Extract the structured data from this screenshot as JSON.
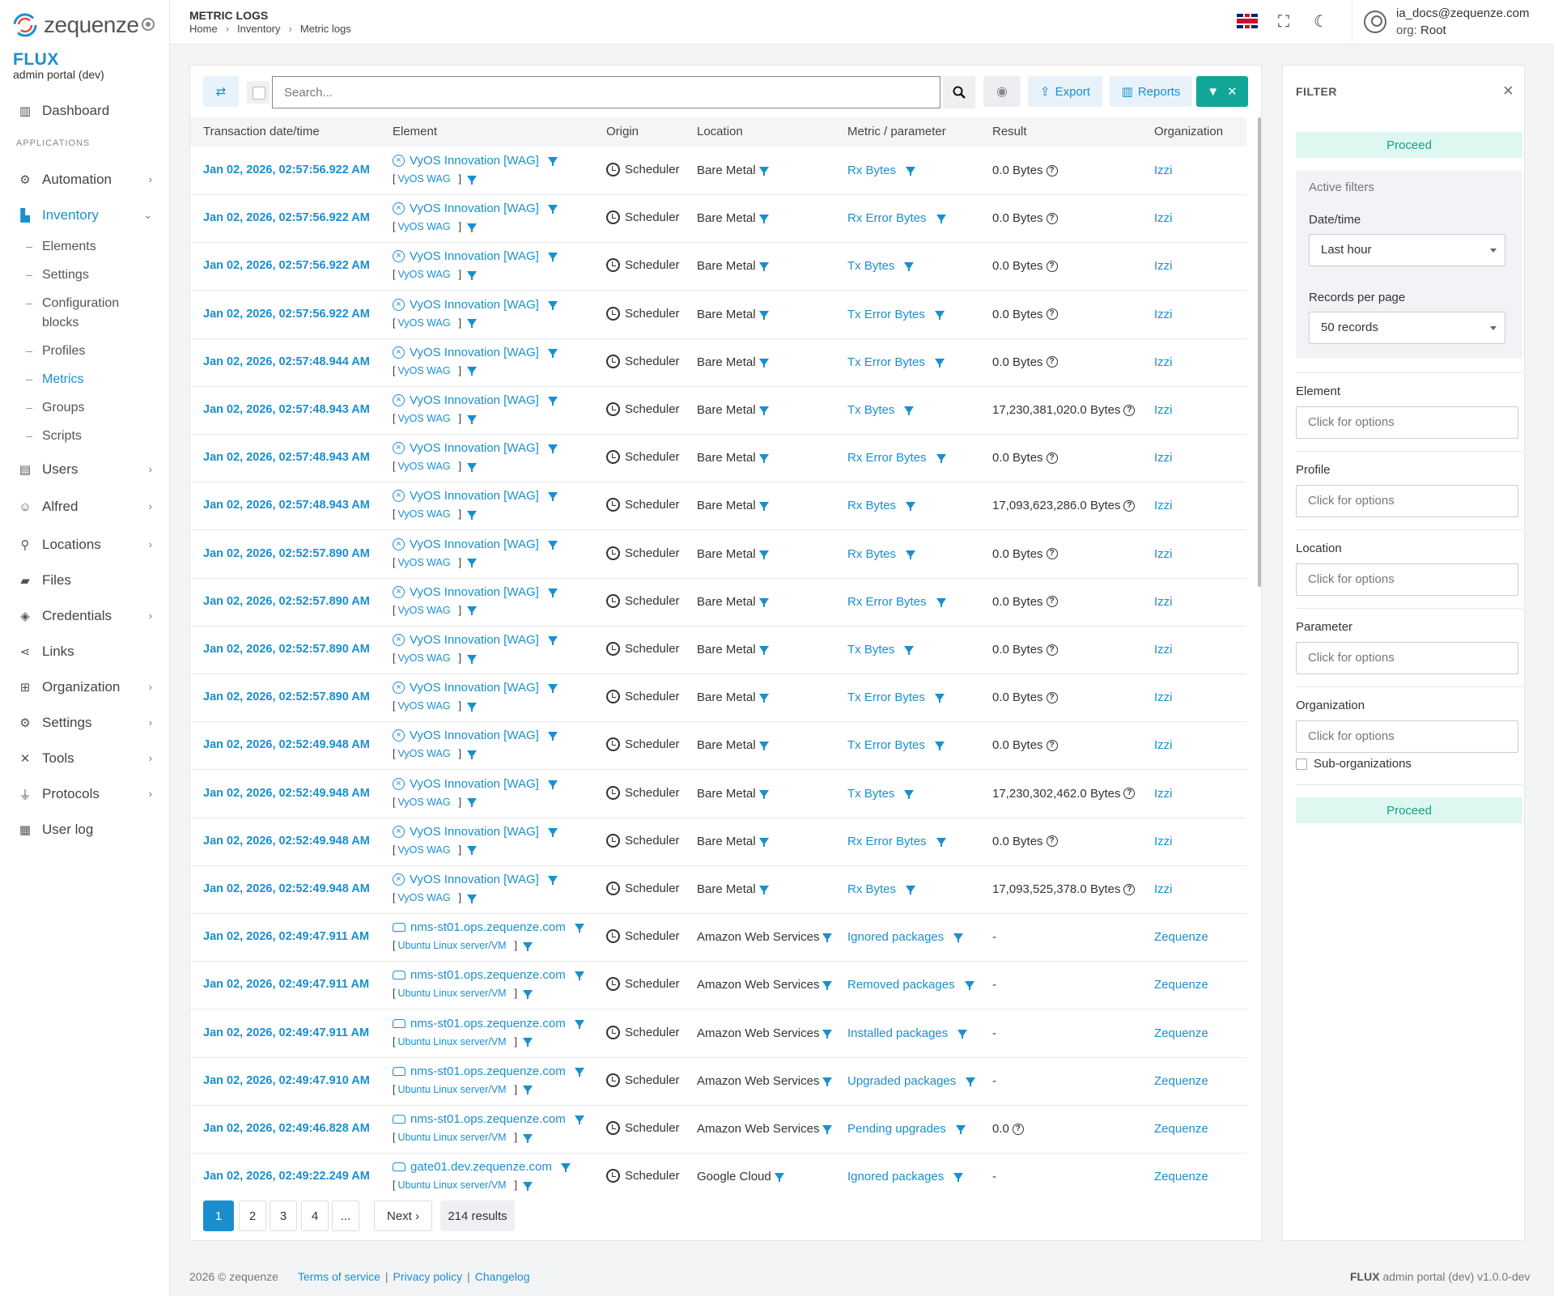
{
  "app": {
    "logo_text": "zequenze",
    "brand": "FLUX",
    "subtitle": "admin portal (dev)"
  },
  "sidebar": {
    "section_label": "APPLICATIONS",
    "items": [
      {
        "label": "Dashboard",
        "icon": "chart-icon"
      },
      {
        "label": "Automation",
        "icon": "automation-icon"
      },
      {
        "label": "Inventory",
        "icon": "inventory-icon"
      },
      {
        "label": "Users",
        "icon": "users-icon"
      },
      {
        "label": "Alfred",
        "icon": "alfred-icon"
      },
      {
        "label": "Locations",
        "icon": "location-pin-icon"
      },
      {
        "label": "Files",
        "icon": "folder-icon"
      },
      {
        "label": "Credentials",
        "icon": "shield-icon"
      },
      {
        "label": "Links",
        "icon": "share-icon"
      },
      {
        "label": "Organization",
        "icon": "org-icon"
      },
      {
        "label": "Settings",
        "icon": "gears-icon"
      },
      {
        "label": "Tools",
        "icon": "tools-icon"
      },
      {
        "label": "Protocols",
        "icon": "plug-icon"
      },
      {
        "label": "User log",
        "icon": "calendar-icon"
      }
    ],
    "inventory_sub": [
      "Elements",
      "Settings",
      "Configuration blocks",
      "Profiles",
      "Metrics",
      "Groups",
      "Scripts"
    ]
  },
  "header": {
    "title": "METRIC LOGS",
    "breadcrumb": [
      "Home",
      "Inventory",
      "Metric logs"
    ],
    "user_email": "ia_docs@zequenze.com",
    "org_label": "org:",
    "org_value": "Root"
  },
  "toolbar": {
    "search_placeholder": "Search...",
    "export_label": "Export",
    "reports_label": "Reports"
  },
  "table": {
    "columns": [
      "Transaction date/time",
      "Element",
      "Origin",
      "Location",
      "Metric / parameter",
      "Result",
      "Organization"
    ],
    "rows": [
      {
        "date": "Jan 02, 2026, 02:57:56.922 AM",
        "element": "VyOS Innovation [WAG]",
        "type": "VyOS WAG",
        "kind": "x",
        "origin": "Scheduler",
        "location": "Bare Metal",
        "metric": "Rx Bytes",
        "result": "0.0 Bytes",
        "help": true,
        "org": "Izzi"
      },
      {
        "date": "Jan 02, 2026, 02:57:56.922 AM",
        "element": "VyOS Innovation [WAG]",
        "type": "VyOS WAG",
        "kind": "x",
        "origin": "Scheduler",
        "location": "Bare Metal",
        "metric": "Rx Error Bytes",
        "result": "0.0 Bytes",
        "help": true,
        "org": "Izzi"
      },
      {
        "date": "Jan 02, 2026, 02:57:56.922 AM",
        "element": "VyOS Innovation [WAG]",
        "type": "VyOS WAG",
        "kind": "x",
        "origin": "Scheduler",
        "location": "Bare Metal",
        "metric": "Tx Bytes",
        "result": "0.0 Bytes",
        "help": true,
        "org": "Izzi"
      },
      {
        "date": "Jan 02, 2026, 02:57:56.922 AM",
        "element": "VyOS Innovation [WAG]",
        "type": "VyOS WAG",
        "kind": "x",
        "origin": "Scheduler",
        "location": "Bare Metal",
        "metric": "Tx Error Bytes",
        "result": "0.0 Bytes",
        "help": true,
        "org": "Izzi"
      },
      {
        "date": "Jan 02, 2026, 02:57:48.944 AM",
        "element": "VyOS Innovation [WAG]",
        "type": "VyOS WAG",
        "kind": "x",
        "origin": "Scheduler",
        "location": "Bare Metal",
        "metric": "Tx Error Bytes",
        "result": "0.0 Bytes",
        "help": true,
        "org": "Izzi"
      },
      {
        "date": "Jan 02, 2026, 02:57:48.943 AM",
        "element": "VyOS Innovation [WAG]",
        "type": "VyOS WAG",
        "kind": "x",
        "origin": "Scheduler",
        "location": "Bare Metal",
        "metric": "Tx Bytes",
        "result": "17,230,381,020.0 Bytes",
        "help": true,
        "org": "Izzi"
      },
      {
        "date": "Jan 02, 2026, 02:57:48.943 AM",
        "element": "VyOS Innovation [WAG]",
        "type": "VyOS WAG",
        "kind": "x",
        "origin": "Scheduler",
        "location": "Bare Metal",
        "metric": "Rx Error Bytes",
        "result": "0.0 Bytes",
        "help": true,
        "org": "Izzi"
      },
      {
        "date": "Jan 02, 2026, 02:57:48.943 AM",
        "element": "VyOS Innovation [WAG]",
        "type": "VyOS WAG",
        "kind": "x",
        "origin": "Scheduler",
        "location": "Bare Metal",
        "metric": "Rx Bytes",
        "result": "17,093,623,286.0 Bytes",
        "help": true,
        "org": "Izzi"
      },
      {
        "date": "Jan 02, 2026, 02:52:57.890 AM",
        "element": "VyOS Innovation [WAG]",
        "type": "VyOS WAG",
        "kind": "x",
        "origin": "Scheduler",
        "location": "Bare Metal",
        "metric": "Rx Bytes",
        "result": "0.0 Bytes",
        "help": true,
        "org": "Izzi"
      },
      {
        "date": "Jan 02, 2026, 02:52:57.890 AM",
        "element": "VyOS Innovation [WAG]",
        "type": "VyOS WAG",
        "kind": "x",
        "origin": "Scheduler",
        "location": "Bare Metal",
        "metric": "Rx Error Bytes",
        "result": "0.0 Bytes",
        "help": true,
        "org": "Izzi"
      },
      {
        "date": "Jan 02, 2026, 02:52:57.890 AM",
        "element": "VyOS Innovation [WAG]",
        "type": "VyOS WAG",
        "kind": "x",
        "origin": "Scheduler",
        "location": "Bare Metal",
        "metric": "Tx Bytes",
        "result": "0.0 Bytes",
        "help": true,
        "org": "Izzi"
      },
      {
        "date": "Jan 02, 2026, 02:52:57.890 AM",
        "element": "VyOS Innovation [WAG]",
        "type": "VyOS WAG",
        "kind": "x",
        "origin": "Scheduler",
        "location": "Bare Metal",
        "metric": "Tx Error Bytes",
        "result": "0.0 Bytes",
        "help": true,
        "org": "Izzi"
      },
      {
        "date": "Jan 02, 2026, 02:52:49.948 AM",
        "element": "VyOS Innovation [WAG]",
        "type": "VyOS WAG",
        "kind": "x",
        "origin": "Scheduler",
        "location": "Bare Metal",
        "metric": "Tx Error Bytes",
        "result": "0.0 Bytes",
        "help": true,
        "org": "Izzi"
      },
      {
        "date": "Jan 02, 2026, 02:52:49.948 AM",
        "element": "VyOS Innovation [WAG]",
        "type": "VyOS WAG",
        "kind": "x",
        "origin": "Scheduler",
        "location": "Bare Metal",
        "metric": "Tx Bytes",
        "result": "17,230,302,462.0 Bytes",
        "help": true,
        "org": "Izzi"
      },
      {
        "date": "Jan 02, 2026, 02:52:49.948 AM",
        "element": "VyOS Innovation [WAG]",
        "type": "VyOS WAG",
        "kind": "x",
        "origin": "Scheduler",
        "location": "Bare Metal",
        "metric": "Rx Error Bytes",
        "result": "0.0 Bytes",
        "help": true,
        "org": "Izzi"
      },
      {
        "date": "Jan 02, 2026, 02:52:49.948 AM",
        "element": "VyOS Innovation [WAG]",
        "type": "VyOS WAG",
        "kind": "x",
        "origin": "Scheduler",
        "location": "Bare Metal",
        "metric": "Rx Bytes",
        "result": "17,093,525,378.0 Bytes",
        "help": true,
        "org": "Izzi"
      },
      {
        "date": "Jan 02, 2026, 02:49:47.911 AM",
        "element": "nms-st01.ops.zequenze.com",
        "type": "Ubuntu Linux server/VM",
        "kind": "srv",
        "origin": "Scheduler",
        "location": "Amazon Web Services",
        "metric": "Ignored packages",
        "result": "-",
        "help": false,
        "org": "Zequenze"
      },
      {
        "date": "Jan 02, 2026, 02:49:47.911 AM",
        "element": "nms-st01.ops.zequenze.com",
        "type": "Ubuntu Linux server/VM",
        "kind": "srv",
        "origin": "Scheduler",
        "location": "Amazon Web Services",
        "metric": "Removed packages",
        "result": "-",
        "help": false,
        "org": "Zequenze"
      },
      {
        "date": "Jan 02, 2026, 02:49:47.911 AM",
        "element": "nms-st01.ops.zequenze.com",
        "type": "Ubuntu Linux server/VM",
        "kind": "srv",
        "origin": "Scheduler",
        "location": "Amazon Web Services",
        "metric": "Installed packages",
        "result": "-",
        "help": false,
        "org": "Zequenze"
      },
      {
        "date": "Jan 02, 2026, 02:49:47.910 AM",
        "element": "nms-st01.ops.zequenze.com",
        "type": "Ubuntu Linux server/VM",
        "kind": "srv",
        "origin": "Scheduler",
        "location": "Amazon Web Services",
        "metric": "Upgraded packages",
        "result": "-",
        "help": false,
        "org": "Zequenze"
      },
      {
        "date": "Jan 02, 2026, 02:49:46.828 AM",
        "element": "nms-st01.ops.zequenze.com",
        "type": "Ubuntu Linux server/VM",
        "kind": "srv",
        "origin": "Scheduler",
        "location": "Amazon Web Services",
        "metric": "Pending upgrades",
        "result": "0.0",
        "help": true,
        "org": "Zequenze"
      },
      {
        "date": "Jan 02, 2026, 02:49:22.249 AM",
        "element": "gate01.dev.zequenze.com",
        "type": "Ubuntu Linux server/VM",
        "kind": "srv",
        "origin": "Scheduler",
        "location": "Google Cloud",
        "metric": "Ignored packages",
        "result": "-",
        "help": false,
        "org": "Zequenze"
      }
    ]
  },
  "pagination": {
    "pages": [
      "1",
      "2",
      "3",
      "4",
      "..."
    ],
    "next_label": "Next ›",
    "results": "214 results"
  },
  "filter": {
    "title": "FILTER",
    "proceed_label": "Proceed",
    "active_title": "Active filters",
    "datetime_label": "Date/time",
    "datetime_value": "Last hour",
    "records_label": "Records per page",
    "records_value": "50 records",
    "fields": [
      "Element",
      "Profile",
      "Location",
      "Parameter",
      "Organization"
    ],
    "placeholder": "Click for options",
    "suborg_label": "Sub-organizations"
  },
  "footer": {
    "copyright": "2026 © zequenze",
    "links": [
      "Terms of service",
      "Privacy policy",
      "Changelog"
    ],
    "version_brand": "FLUX",
    "version_text": "admin portal (dev) v1.0.0-dev"
  },
  "colors": {
    "accent": "#1a8fcf",
    "teal": "#11a697",
    "proceed_bg": "#def7f1"
  }
}
